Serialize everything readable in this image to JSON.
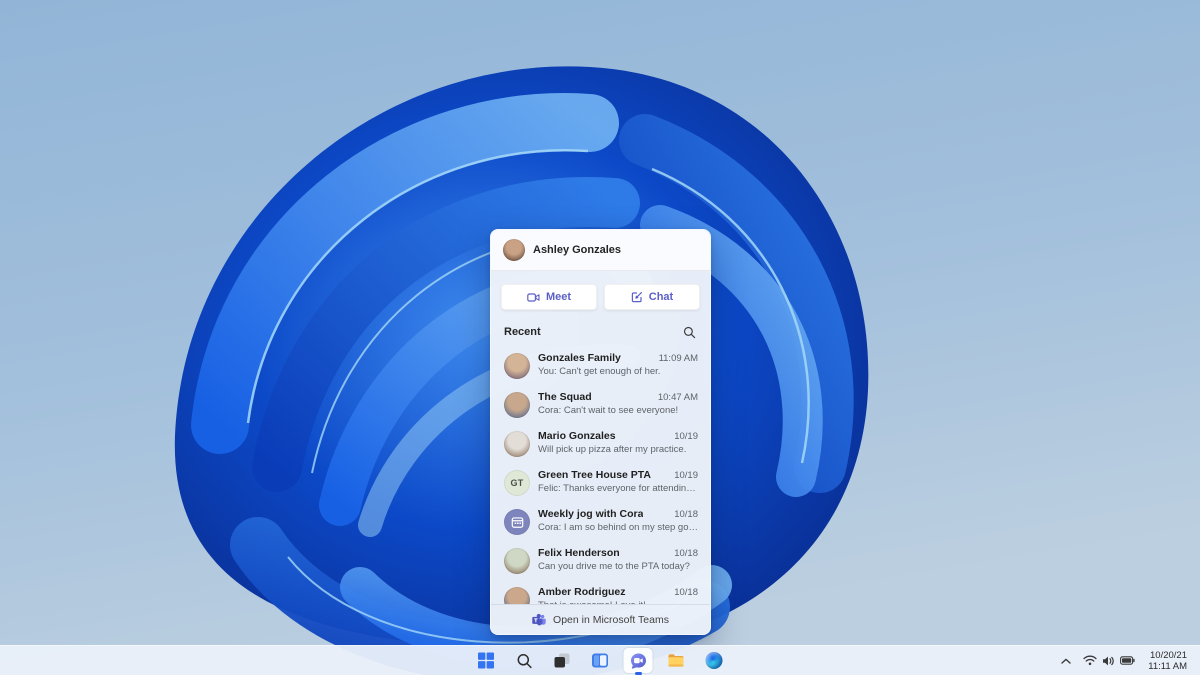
{
  "wallpaper": {
    "name": "windows-11-bloom",
    "sky_color": "#9bbbdb",
    "bloom_blue": "#0b49c8",
    "bloom_highlight": "#a5d8f8"
  },
  "chat_panel": {
    "header": {
      "name": "Ashley Gonzales",
      "avatar": {
        "type": "photo",
        "colors": [
          "#c9a184",
          "#4a3328"
        ]
      }
    },
    "accent_color": "#5b5fc7",
    "actions": [
      {
        "label": "Meet",
        "icon": "video-camera-icon"
      },
      {
        "label": "Chat",
        "icon": "compose-icon"
      }
    ],
    "recent_label": "Recent",
    "search_icon": "search-icon",
    "conversations": [
      {
        "name": "Gonzales Family",
        "preview": "You: Can't get enough of her.",
        "time": "11:09 AM",
        "avatar": {
          "type": "photo",
          "colors": [
            "#d3b497",
            "#5a4a6b"
          ]
        }
      },
      {
        "name": "The Squad",
        "preview": "Cora: Can't wait to see everyone!",
        "time": "10:47 AM",
        "avatar": {
          "type": "photo",
          "colors": [
            "#c7a88d",
            "#3f5a8f"
          ]
        }
      },
      {
        "name": "Mario Gonzales",
        "preview": "Will pick up pizza after my practice.",
        "time": "10/19",
        "avatar": {
          "type": "photo",
          "colors": [
            "#e2ddd6",
            "#7d5f48"
          ]
        }
      },
      {
        "name": "Green Tree House PTA",
        "preview": "Felic: Thanks everyone for attending today.",
        "time": "10/19",
        "avatar": {
          "type": "initials",
          "text": "GT",
          "bg": "#dfe7d7",
          "fg": "#49524a"
        }
      },
      {
        "name": "Weekly jog with Cora",
        "preview": "Cora: I am so behind on my step goals.",
        "time": "10/18",
        "avatar": {
          "type": "icon",
          "icon": "calendar-icon",
          "bg": "#7e85bd"
        }
      },
      {
        "name": "Felix Henderson",
        "preview": "Can you drive me to the PTA today?",
        "time": "10/18",
        "avatar": {
          "type": "photo",
          "colors": [
            "#cfd8c4",
            "#7a5c46"
          ]
        }
      },
      {
        "name": "Amber Rodriguez",
        "preview": "That is awesome! Love it!",
        "time": "10/18",
        "avatar": {
          "type": "photo",
          "colors": [
            "#cba88b",
            "#2f4f8f"
          ]
        }
      }
    ],
    "footer": {
      "label": "Open in Microsoft Teams",
      "icon": "microsoft-teams-icon",
      "icon_color": "#5b5fc7"
    }
  },
  "taskbar": {
    "buttons": [
      {
        "id": "start",
        "icon": "windows-logo-icon"
      },
      {
        "id": "search",
        "icon": "search-icon"
      },
      {
        "id": "task-view",
        "icon": "task-view-icon"
      },
      {
        "id": "widgets",
        "icon": "widgets-icon"
      },
      {
        "id": "chat",
        "icon": "teams-chat-icon",
        "active": true
      },
      {
        "id": "file-explorer",
        "icon": "folder-icon"
      },
      {
        "id": "edge",
        "icon": "edge-browser-icon"
      }
    ],
    "tray": {
      "icons": [
        "chevron-up-icon",
        "wifi-icon",
        "volume-icon",
        "battery-icon"
      ],
      "date": "10/20/21",
      "time": "11:11 AM"
    }
  }
}
